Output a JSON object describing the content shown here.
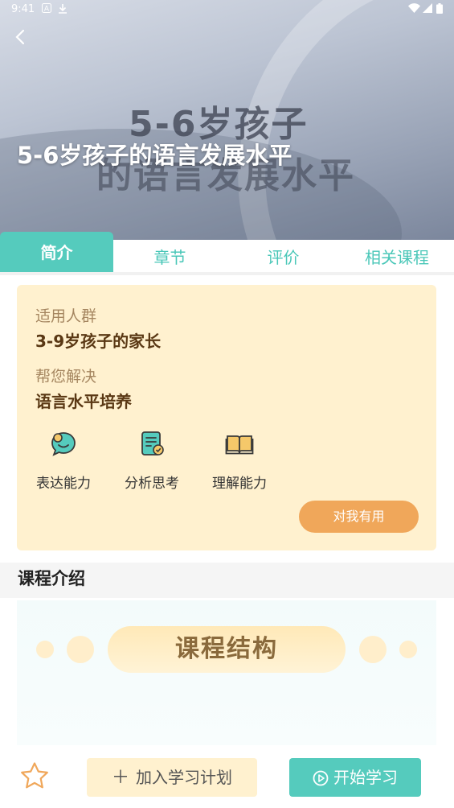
{
  "status_bar": {
    "time": "9:41",
    "icons": [
      "a-icon",
      "download-icon",
      "wifi-icon",
      "signal-icon",
      "battery-icon"
    ]
  },
  "header": {
    "back_icon": "chevron-left-icon",
    "title": "5-6岁孩子的语言发展水平",
    "cover_line1": "5-6岁孩子",
    "cover_line2": "的语言发展水平"
  },
  "tabs": [
    {
      "label": "简介",
      "active": true
    },
    {
      "label": "章节",
      "active": false
    },
    {
      "label": "评价",
      "active": false
    },
    {
      "label": "相关课程",
      "active": false
    }
  ],
  "info": {
    "audience_label": "适用人群",
    "audience_value": "3-9岁孩子的家长",
    "solve_label": "帮您解决",
    "solve_value": "语言水平培养",
    "features": [
      {
        "label": "表达能力",
        "icon": "speech-bubble-icon"
      },
      {
        "label": "分析思考",
        "icon": "checklist-icon"
      },
      {
        "label": "理解能力",
        "icon": "book-icon"
      }
    ],
    "useful_button": "对我有用"
  },
  "intro": {
    "title": "课程介绍",
    "banner_text": "课程结构"
  },
  "bottom_bar": {
    "favorite_icon": "star-icon",
    "add_plan": "加入学习计划",
    "add_icon": "plus-icon",
    "start": "开始学习",
    "start_icon": "play-icon"
  },
  "colors": {
    "teal": "#55cbbd",
    "orange": "#f0a75a",
    "cream": "#fff1cf",
    "brown": "#5a3814"
  }
}
